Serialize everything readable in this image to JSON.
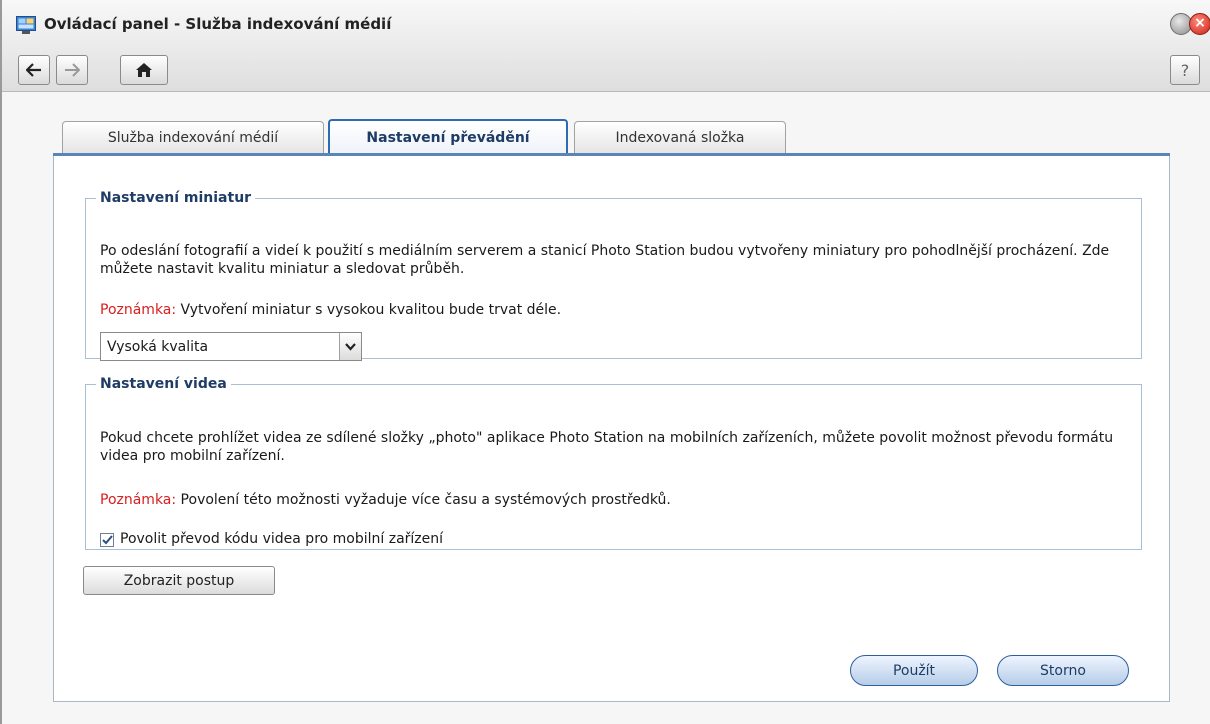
{
  "window": {
    "title": "Ovládací panel - Služba indexování médií",
    "help_label": "?"
  },
  "icons": {
    "app": "control-panel-icon",
    "minimize": "minimize-icon",
    "close": "close-icon",
    "back": "arrow-left-icon",
    "forward": "arrow-right-icon",
    "home": "home-icon",
    "dropdown": "chevron-down-icon",
    "check": "checkmark-icon"
  },
  "tabs": [
    {
      "label": "Služba indexování médií",
      "active": false
    },
    {
      "label": "Nastavení převádění",
      "active": true
    },
    {
      "label": "Indexovaná složka",
      "active": false
    }
  ],
  "thumbnail_section": {
    "title": "Nastavení miniatur",
    "description": "Po odeslání fotografií a videí k použití s mediálním serverem a stanicí Photo Station budou vytvořeny miniatury pro pohodlnější procházení. Zde můžete nastavit kvalitu miniatur a sledovat průběh.",
    "note_label": "Poznámka:",
    "note_text": " Vytvoření miniatur s vysokou kvalitou bude trvat déle.",
    "quality_select_value": "Vysoká kvalita"
  },
  "video_section": {
    "title": "Nastavení videa",
    "description": "Pokud chcete prohlížet videa ze sdílené složky „photo\" aplikace Photo Station na mobilních zařízeních, můžete povolit možnost převodu formátu videa pro mobilní zařízení.",
    "note_label": "Poznámka:",
    "note_text": " Povolení této možnosti vyžaduje více času a systémových prostředků.",
    "checkbox_label": "Povolit převod kódu videa pro mobilní zařízení",
    "checkbox_checked": true
  },
  "buttons": {
    "show_progress": "Zobrazit postup",
    "apply": "Použít",
    "cancel": "Storno"
  },
  "colors": {
    "accent": "#2f6bb0",
    "note": "#d81e1e",
    "section_title": "#1f3c66"
  }
}
